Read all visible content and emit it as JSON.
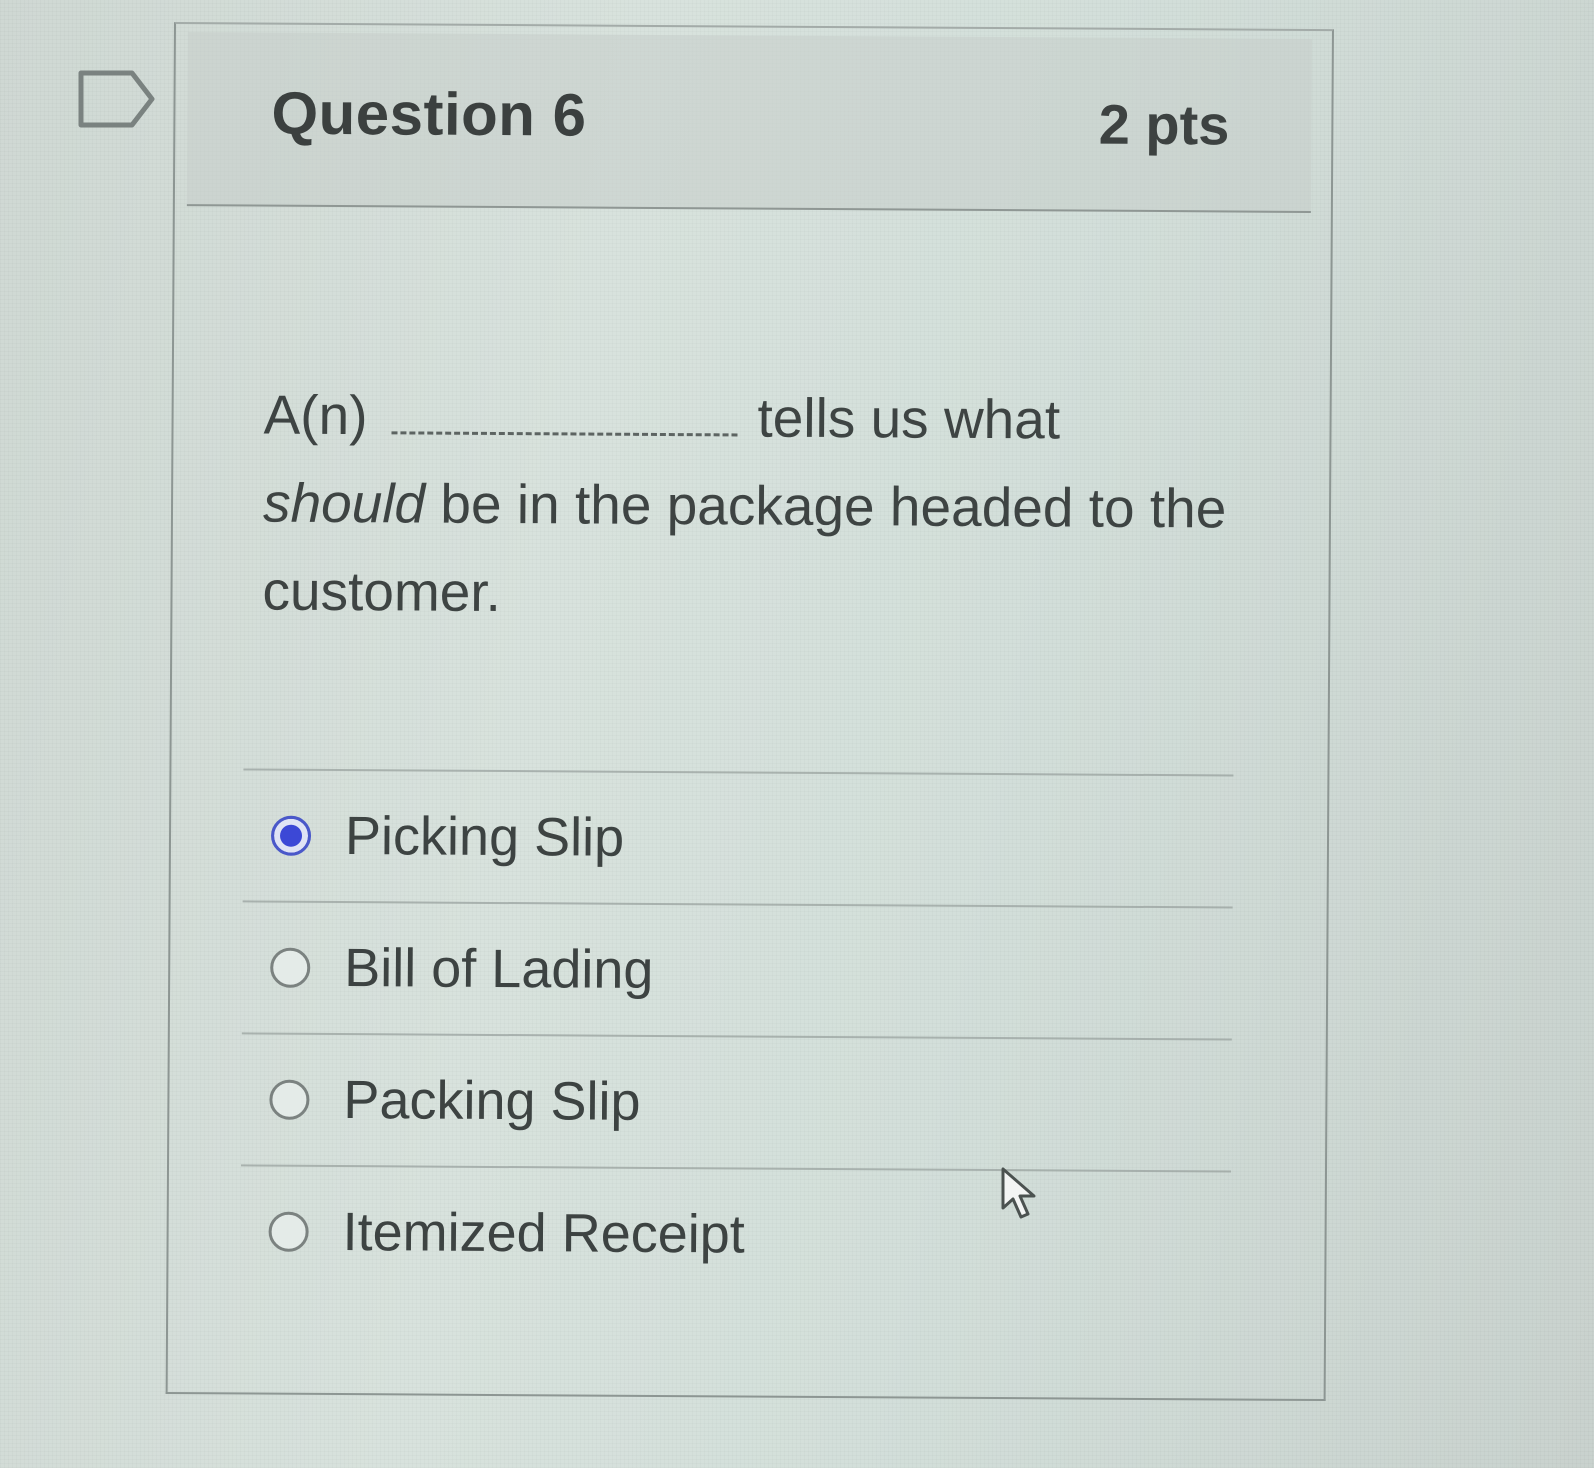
{
  "question": {
    "title": "Question 6",
    "points": "2 pts",
    "text_prefix": "A(n)",
    "text_after_blank": "tells us what",
    "text_italic": "should",
    "text_rest": "be in the package headed to the customer."
  },
  "answers": [
    {
      "label": "Picking Slip",
      "selected": true
    },
    {
      "label": "Bill of Lading",
      "selected": false
    },
    {
      "label": "Packing Slip",
      "selected": false
    },
    {
      "label": "Itemized Receipt",
      "selected": false
    }
  ],
  "colors": {
    "selected_radio": "#3c48d6",
    "text": "#3d4342"
  },
  "icons": {
    "flag": "flag-outline-icon",
    "cursor": "mouse-pointer-icon"
  }
}
